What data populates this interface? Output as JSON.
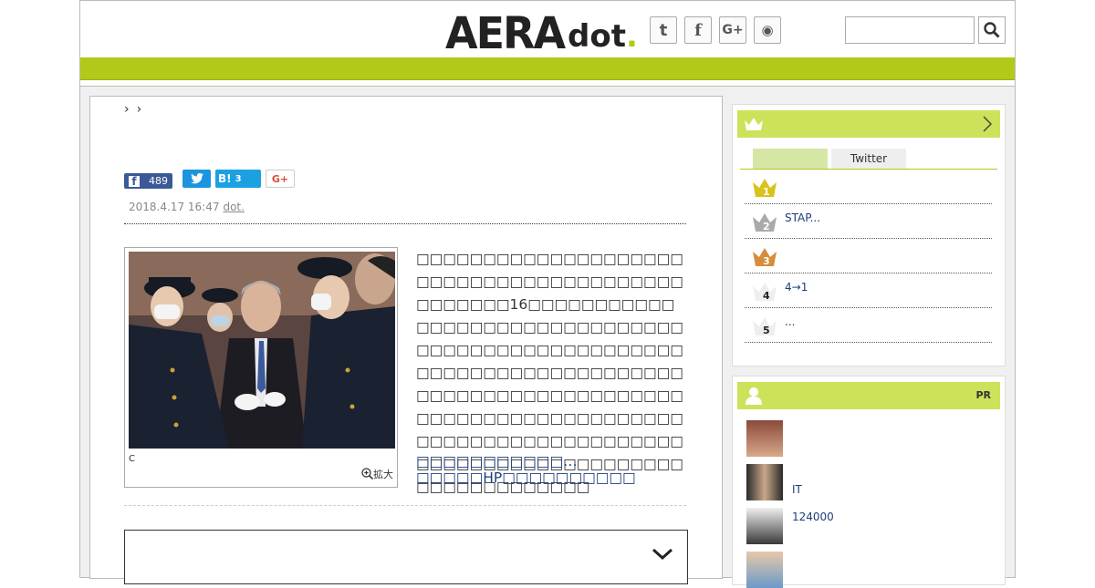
{
  "header": {
    "logo_main": "AERA",
    "logo_sub": "dot",
    "logo_dot": ".",
    "social_icons": [
      "twitter-icon",
      "facebook-icon",
      "googleplus-icon",
      "rss-icon"
    ],
    "social_glyphs": [
      "t",
      "f",
      "G+",
      "◉"
    ],
    "search_placeholder": ""
  },
  "article": {
    "breadcrumb": [
      "›",
      "›"
    ],
    "share": {
      "facebook_count": "489",
      "hatena_label": "B!",
      "hatena_count": "3",
      "gplus_label": "G+"
    },
    "date": "2018.4.17 16:47",
    "source": "dot.",
    "photo_caption": "C",
    "zoom_label": "拡大",
    "body": "□□□□□□□□□□□□□□□□□□□□□□□□□□□□□□□□□□□□□□□□□□□□□□□16□□□□□□□□□□□□□□□□□□□□□□□□□□□□□□□□□□□□□□□□□□□□□□□□□□□□□□□□□□□□□□□□□□□□□□□□□□□□□□□□□□□□□□□□□□□□□□□□□□□□□□□□□□□□□□□□□□□□□□□□□□□□□□□□□□□□□□□□□□□□□□□□□□□□□□□□□□□□□□□□□□□□",
    "related_link": "□□□□□□□□□□□…□□□□□HP□□□□□□□□□□"
  },
  "sidebar": {
    "ranking": {
      "tabs": [
        "",
        "Twitter"
      ],
      "items": [
        {
          "rank": "1",
          "text": ""
        },
        {
          "rank": "2",
          "text": "STAP..."
        },
        {
          "rank": "3",
          "text": ""
        },
        {
          "rank": "4",
          "text": "4→1"
        },
        {
          "rank": "5",
          "text": "..."
        }
      ]
    },
    "pr": {
      "label": "PR",
      "items": [
        "",
        "IT",
        "124000",
        ""
      ]
    }
  },
  "colors": {
    "brand_green": "#b3c91a",
    "side_head": "#cde25a",
    "link_blue": "#1d3f7a"
  }
}
